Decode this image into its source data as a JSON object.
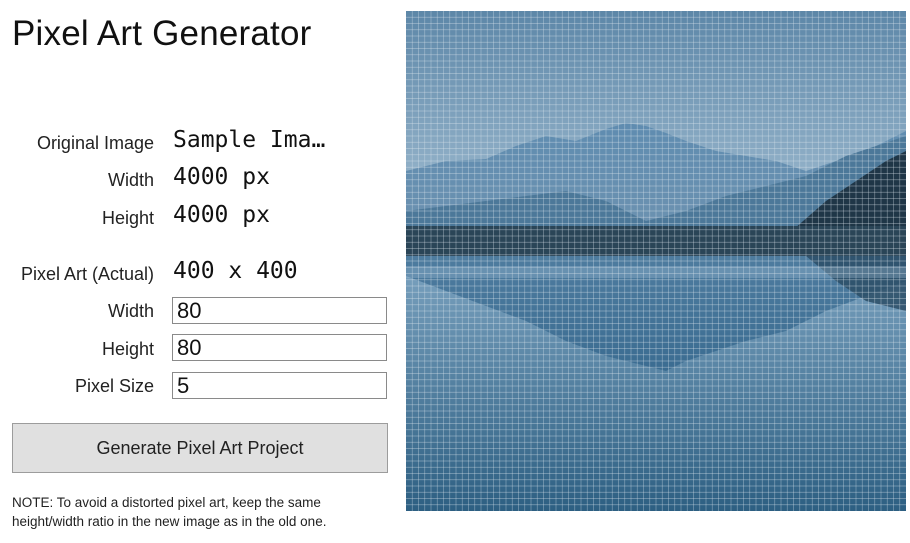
{
  "app": {
    "title": "Pixel Art Generator"
  },
  "original": {
    "image_label": "Original Image",
    "image_value": "Sample Ima…",
    "width_label": "Width",
    "width_value": "4000 px",
    "height_label": "Height",
    "height_value": "4000 px"
  },
  "pixel_art": {
    "actual_label": "Pixel Art (Actual)",
    "actual_value": "400 x 400",
    "width_label": "Width",
    "width_input": "80",
    "height_label": "Height",
    "height_input": "80",
    "pixel_size_label": "Pixel Size",
    "pixel_size_input": "5"
  },
  "actions": {
    "generate_label": "Generate Pixel Art Project"
  },
  "note": "NOTE: To avoid a distorted pixel art, keep the same height/width ratio in the new image as in the old one.",
  "preview": {
    "grid_cells": 80,
    "colors": {
      "sky_top": "#5d87a8",
      "sky_bottom": "#a9c3d6",
      "mountain": "#4f7ea5",
      "mountain_dark": "#20384c",
      "water_top": "#7ca3c0",
      "water_bottom": "#2d5f82",
      "grid_line": "#dfe8ef"
    }
  }
}
